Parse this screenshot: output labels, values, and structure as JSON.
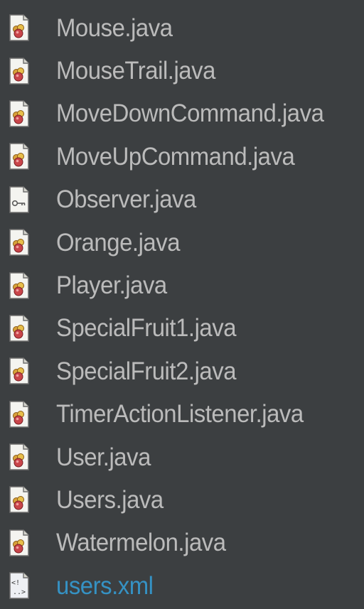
{
  "colors": {
    "background": "#3c3f41",
    "text": "#bbbbbb",
    "xml_text": "#3592c4"
  },
  "files": [
    {
      "name": "Mouse.java",
      "icon": "java-class-icon"
    },
    {
      "name": "MouseTrail.java",
      "icon": "java-class-icon"
    },
    {
      "name": "MoveDownCommand.java",
      "icon": "java-class-icon"
    },
    {
      "name": "MoveUpCommand.java",
      "icon": "java-class-icon"
    },
    {
      "name": "Observer.java",
      "icon": "java-interface-icon"
    },
    {
      "name": "Orange.java",
      "icon": "java-class-icon"
    },
    {
      "name": "Player.java",
      "icon": "java-class-icon"
    },
    {
      "name": "SpecialFruit1.java",
      "icon": "java-class-icon"
    },
    {
      "name": "SpecialFruit2.java",
      "icon": "java-class-icon"
    },
    {
      "name": "TimerActionListener.java",
      "icon": "java-class-icon"
    },
    {
      "name": "User.java",
      "icon": "java-class-icon"
    },
    {
      "name": "Users.java",
      "icon": "java-class-icon"
    },
    {
      "name": "Watermelon.java",
      "icon": "java-class-icon"
    },
    {
      "name": "users.xml",
      "icon": "xml-file-icon"
    }
  ]
}
